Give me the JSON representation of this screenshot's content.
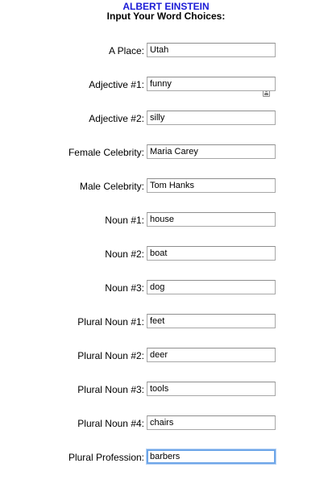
{
  "header": {
    "title": "ALBERT EINSTEIN",
    "subtitle": "Input Your Word Choices:"
  },
  "fields": [
    {
      "label": "A Place:",
      "value": "Utah"
    },
    {
      "label": "Adjective #1:",
      "value": "funny"
    },
    {
      "label": "Adjective #2:",
      "value": "silly"
    },
    {
      "label": "Female Celebrity:",
      "value": "Maria Carey"
    },
    {
      "label": "Male Celebrity:",
      "value": "Tom Hanks"
    },
    {
      "label": "Noun #1:",
      "value": "house"
    },
    {
      "label": "Noun #2:",
      "value": "boat"
    },
    {
      "label": "Noun #3:",
      "value": "dog"
    },
    {
      "label": "Plural Noun #1:",
      "value": "feet"
    },
    {
      "label": "Plural Noun #2:",
      "value": "deer"
    },
    {
      "label": "Plural Noun #3:",
      "value": "tools"
    },
    {
      "label": "Plural Noun #4:",
      "value": "chairs"
    },
    {
      "label": "Plural Profession:",
      "value": "barbers"
    }
  ],
  "icons": {
    "autofill": "contact-card-icon"
  },
  "colors": {
    "title": "#1a1ad6",
    "focus_ring": "#6ea6e8"
  }
}
